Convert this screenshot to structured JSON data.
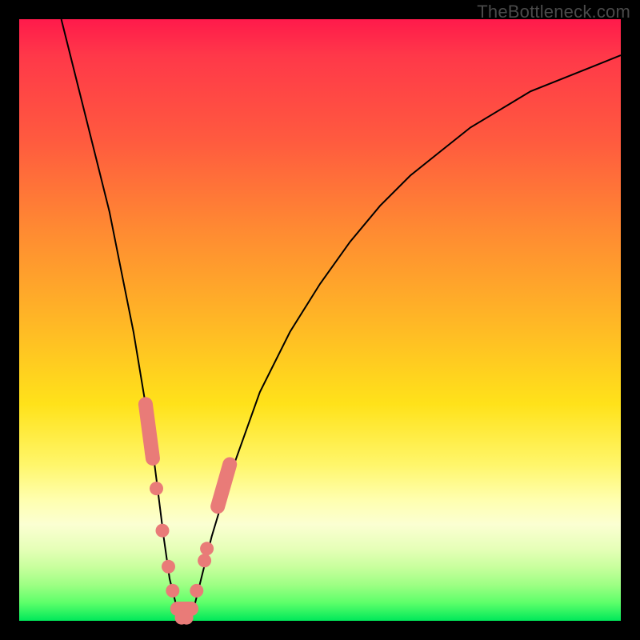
{
  "watermark": "TheBottleneck.com",
  "chart_data": {
    "type": "line",
    "title": "",
    "xlabel": "",
    "ylabel": "",
    "xlim": [
      0,
      100
    ],
    "ylim": [
      0,
      100
    ],
    "grid": false,
    "legend": false,
    "series": [
      {
        "name": "bottleneck-curve",
        "x": [
          7,
          10,
          13,
          15,
          17,
          19,
          20,
          21,
          22,
          23,
          24,
          25,
          26,
          27,
          28,
          29,
          30,
          32,
          35,
          40,
          45,
          50,
          55,
          60,
          65,
          70,
          75,
          80,
          85,
          90,
          95,
          100
        ],
        "y": [
          100,
          88,
          76,
          68,
          58,
          48,
          42,
          36,
          30,
          22,
          14,
          7,
          3,
          0,
          0,
          2,
          6,
          14,
          24,
          38,
          48,
          56,
          63,
          69,
          74,
          78,
          82,
          85,
          88,
          90,
          92,
          94
        ]
      }
    ],
    "markers": {
      "name": "highlight-points",
      "shape": "circle",
      "color": "#e97b78",
      "points": [
        {
          "x": 21.0,
          "y": 36
        },
        {
          "x": 21.5,
          "y": 32
        },
        {
          "x": 22.0,
          "y": 28
        },
        {
          "x": 22.8,
          "y": 22
        },
        {
          "x": 23.8,
          "y": 15
        },
        {
          "x": 24.8,
          "y": 9
        },
        {
          "x": 25.5,
          "y": 5
        },
        {
          "x": 26.3,
          "y": 2
        },
        {
          "x": 27.0,
          "y": 0.5
        },
        {
          "x": 27.8,
          "y": 0.5
        },
        {
          "x": 28.6,
          "y": 2
        },
        {
          "x": 29.5,
          "y": 5
        },
        {
          "x": 30.8,
          "y": 10
        },
        {
          "x": 31.2,
          "y": 12
        },
        {
          "x": 33.0,
          "y": 19
        },
        {
          "x": 33.8,
          "y": 22
        },
        {
          "x": 34.4,
          "y": 24
        },
        {
          "x": 35.0,
          "y": 26
        }
      ],
      "pills": [
        {
          "x1": 21.0,
          "y1": 36,
          "x2": 22.2,
          "y2": 27
        },
        {
          "x1": 26.3,
          "y1": 2,
          "x2": 28.6,
          "y2": 2
        },
        {
          "x1": 33.0,
          "y1": 19,
          "x2": 35.0,
          "y2": 26
        }
      ]
    },
    "background_gradient": {
      "top": "#ff1a4b",
      "mid_upper": "#ff8a32",
      "mid": "#ffe21a",
      "mid_lower": "#ffffb0",
      "bottom": "#00e85a"
    }
  }
}
